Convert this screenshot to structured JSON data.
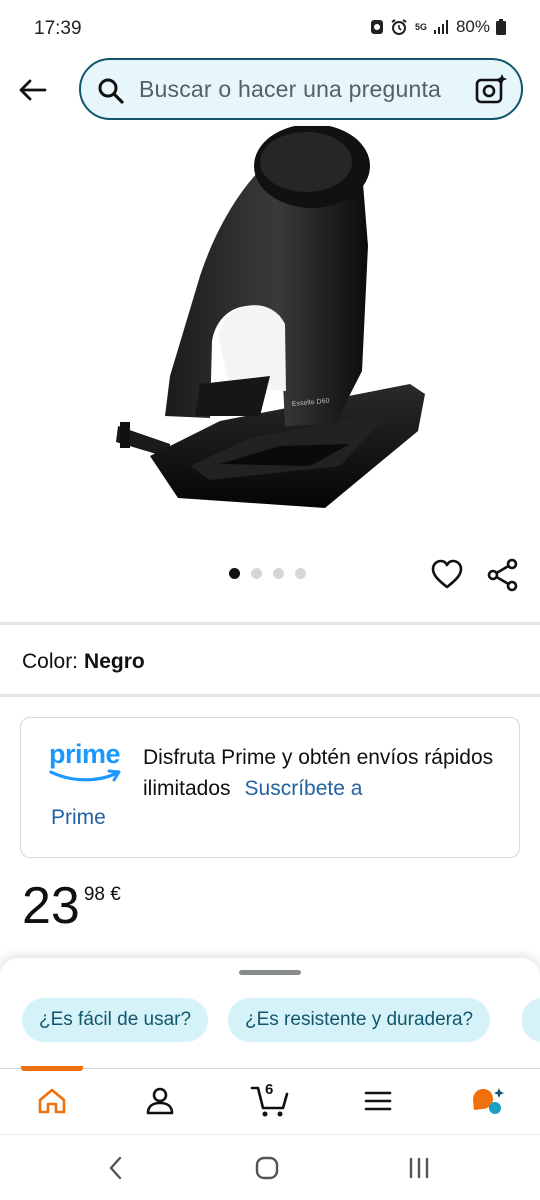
{
  "status_bar": {
    "time": "17:39",
    "network": "5G",
    "battery": "80%",
    "icons": [
      "app-notification-icon",
      "alarm-icon",
      "5g-icon",
      "signal-icon",
      "battery-icon"
    ]
  },
  "search": {
    "placeholder": "Buscar o hacer una pregunta",
    "icons": [
      "back-arrow-icon",
      "search-icon",
      "camera-search-icon"
    ]
  },
  "product": {
    "image_name": "product-image-hole-punch",
    "carousel": {
      "total": 4,
      "active": 1
    },
    "actions": [
      "heart-icon",
      "share-icon"
    ],
    "color_label": "Color:",
    "color_value": "Negro"
  },
  "prime_promo": {
    "logo_text": "prime",
    "text": "Disfruta Prime y obtén envíos rápidos ilimitados",
    "link_part1": "Suscríbete a",
    "link_part2": "Prime"
  },
  "price": {
    "whole": "23",
    "fraction": "98 €"
  },
  "assistant_chips": [
    "¿Es fácil de usar?",
    "¿Es resistente y duradera?"
  ],
  "bottom_nav": {
    "items": [
      "home-icon",
      "account-icon",
      "cart-icon",
      "menu-icon",
      "rufus-assistant-icon"
    ],
    "cart_count": "6",
    "active": "home"
  },
  "colors": {
    "search_border": "#11566c",
    "search_bg": "#e6f6fa",
    "link": "#2162a1",
    "chip_bg": "#d5f2f8",
    "chip_text": "#11566c",
    "accent_orange": "#f0700b",
    "prime_blue": "#1a98ff"
  }
}
